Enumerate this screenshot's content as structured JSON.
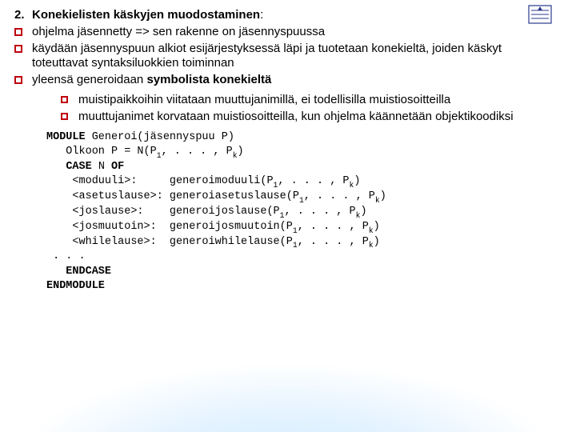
{
  "logo_name": "institution-logo",
  "main": {
    "number": "2.",
    "title_a": "Konekielisten käskyjen muodostaminen",
    "title_colon": ":",
    "b1": "ohjelma jäsennetty => sen rakenne on jäsennyspuussa",
    "b2": "käydään jäsennyspuun alkiot esijärjestyksessä läpi ja tuotetaan konekieltä, joiden käskyt toteuttavat syntaksiluokkien toiminnan",
    "b3_pre": "yleensä generoidaan ",
    "b3_bold": "symbolista konekieltä"
  },
  "sub": {
    "s1": "muistipaikkoihin viitataan muuttujanimillä, ei todellisilla muistiosoitteilla",
    "s2": "muuttujanimet korvataan muistiosoitteilla, kun ohjelma käännetään objektikoodiksi"
  },
  "code": {
    "l1_a": "MODULE",
    "l1_b": " Generoi(jäsennyspuu P)",
    "l2_a": "   Olkoon P = N(P",
    "l2_b": ", . . . , P",
    "l2_c": ")",
    "l3_a": "   ",
    "l3_kw": "CASE",
    "l3_b": " N ",
    "l3_kw2": "OF",
    "l4": "    <moduuli>:     generoimoduuli(P",
    "l5": "    <asetuslause>: generoiasetuslause(P",
    "l6": "    <joslause>:    generoijoslause(P",
    "l7": "    <josmuutoin>:  generoijosmuutoin(P",
    "l8": "    <whilelause>:  generoiwhilelause(P",
    "tail_a": ", . . . , P",
    "tail_b": ")",
    "l9": " . . .",
    "l10": "   ENDCASE",
    "l11": "ENDMODULE",
    "sub1": "1",
    "subk": "k"
  }
}
